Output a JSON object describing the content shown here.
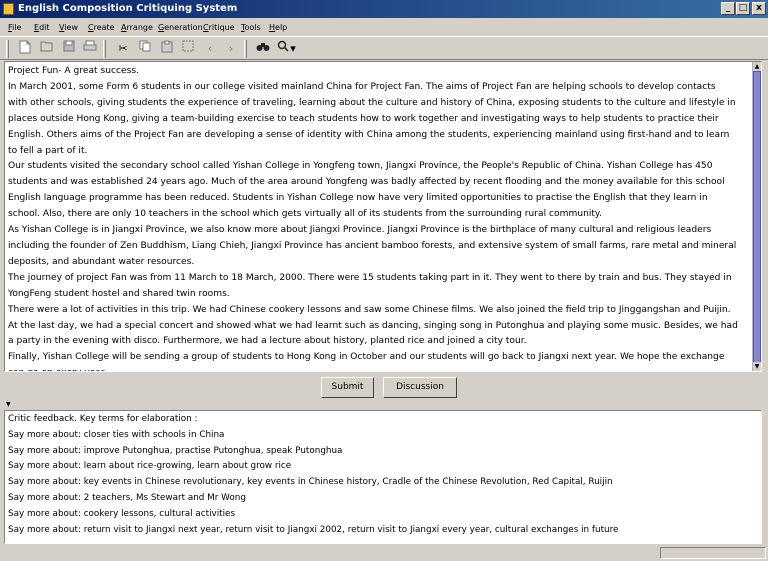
{
  "window": {
    "title": "English Composition Critiquing System",
    "controls": {
      "minimize": "_",
      "maximize": "□",
      "close": "x"
    }
  },
  "menu": [
    "File",
    "Edit",
    "View",
    "Create",
    "Arrange",
    "Generation",
    "Critique",
    "Tools",
    "Help"
  ],
  "toolbar": {
    "icons": [
      "new-document-icon",
      "open-icon",
      "save-icon",
      "print-icon",
      "cut-icon",
      "copy-icon",
      "paste-icon",
      "select-all-icon",
      "back-icon",
      "forward-icon",
      "binoculars-icon",
      "find-replace-icon"
    ],
    "glyphs": {
      "dropdown": "▾",
      "back": "‹",
      "forward": "›"
    }
  },
  "essay": {
    "text": "Project Fun- A great success.\nIn March 2001, some Form 6 students in our college visited mainland China for Project Fan. The aims of Project Fan are helping schools to develop contacts\nwith other schools, giving students the experience of traveling, learning about the culture and history of China, exposing students to the culture and lifestyle in\nplaces outside Hong Kong, giving a team-building exercise to teach students how to work together and investigating ways to help students to practice their\nEnglish. Others aims of the Project Fan are developing a sense of identity with China among the students, experiencing mainland using first-hand and to learn\nto fell a part of it.\nOur students visited the secondary school called Yishan College in Yongfeng town, Jiangxi Province, the People's Republic of China. Yishan College has 450\nstudents and was established 24 years ago. Much of the area around Yongfeng was badly affected by recent flooding and the money available for this school\nEnglish language programme has been reduced. Students in Yishan College now have very limited opportunities to practise the English that they learn in\nschool. Also, there are only 10 teachers in the school which gets virtually all of its students from the surrounding rural community.\nAs Yishan College is in Jiangxi Province, we also know more about Jiangxi Province. Jiangxi Province is the birthplace of many cultural and religious leaders\nincluding the founder of Zen Buddhism, Liang Chieh, Jiangxi Province has ancient bamboo forests, and extensive system of small farms, rare metal and mineral\ndeposits, and abundant water resources.\nThe journey of project Fan was from 11 March to 18 March, 2000. There were 15 students taking part in it. They went to there by train and bus. They stayed in\nYongFeng student hostel and shared twin rooms.\nThere were a lot of activities in this trip. We had Chinese cookery lessons and saw some Chinese films. We also joined the field trip to Jinggangshan and Puijin.\nAt the last day, we had a special concert and showed what we had learnt such as dancing, singing song in Putonghua and playing some music. Besides, we had\na party in the evening with disco. Furthermore, we had a lecture about history, planted rice and joined a city tour.\nFinally, Yishan College will be sending a group of students to Hong Kong in October and our students will go back to Jiangxi next year. We hope the exchange\ncan go on every year."
  },
  "buttons": {
    "submit": "Submit",
    "discussion": "Discussion"
  },
  "feedback": {
    "lines": [
      "Critic feedback. Key terms for elaboration :",
      "Say more about: closer ties with schools in China",
      "Say more about: improve Putonghua, practise Putonghua, speak Putonghua",
      "Say more about: learn about rice-growing, learn about grow rice",
      "Say more about: key events in Chinese revolutionary, key events in Chinese history, Cradle of the Chinese Revolution, Red Capital, Ruijin",
      "Say more about: 2 teachers, Ms Stewart and Mr Wong",
      "Say more about: cookery lessons, cultural activities",
      "Say more about: return visit to Jiangxi next year, return visit to Jiangxi 2002, return visit to Jiangxi every year, cultural exchanges in future"
    ]
  }
}
